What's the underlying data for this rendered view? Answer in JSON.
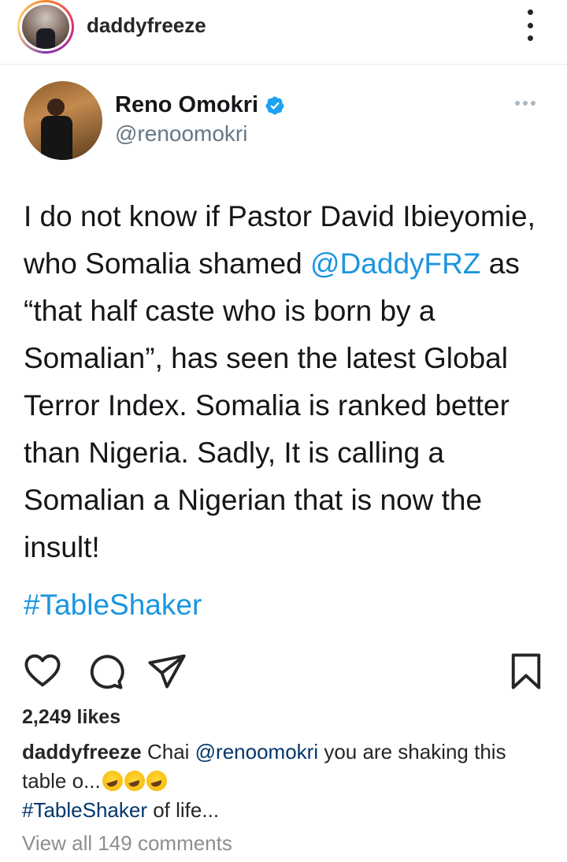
{
  "post": {
    "username": "daddyfreeze",
    "likes": "2,249 likes",
    "view_all_comments": "View all 149 comments"
  },
  "tweet": {
    "name": "Reno Omokri",
    "handle": "@renoomokri",
    "text_part1": "I do not know if Pastor David Ibieyomie, who Somalia shamed ",
    "mention": "@DaddyFRZ",
    "text_part2": " as “that half caste who is born by a Somalian”, has seen the latest Global Terror Index. Somalia is ranked better than Nigeria. Sadly, It is calling a Somalian a Nigerian that is now the insult!",
    "hashtag": "#TableShaker"
  },
  "caption": {
    "user": "daddyfreeze",
    "word1": " Chai ",
    "mention": "@renoomokri",
    "text": " you are shaking this table o...",
    "emoji_names": [
      "rolling-on-floor-laughing",
      "rolling-on-floor-laughing",
      "rolling-on-floor-laughing"
    ],
    "hashtag": "#TableShaker",
    "trailing": " of life..."
  },
  "colors": {
    "twitter_blue": "#1b95e0",
    "instagram_link": "#00376b",
    "muted": "#8e8e8e"
  },
  "icons": [
    "heart-icon",
    "comment-icon",
    "share-icon",
    "bookmark-icon",
    "verified-icon",
    "more-options-icon"
  ]
}
